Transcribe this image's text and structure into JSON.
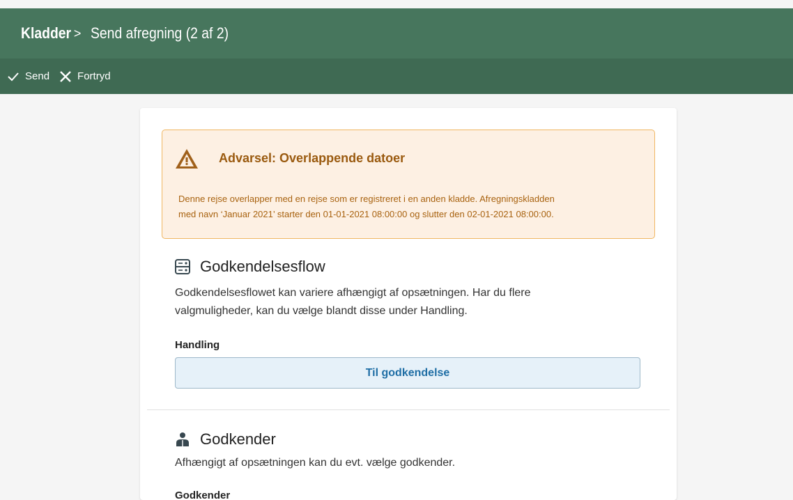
{
  "header": {
    "root": "Kladder",
    "separator": ">",
    "current": "Send afregning (2 af 2)"
  },
  "toolbar": {
    "send_label": "Send",
    "cancel_label": "Fortryd"
  },
  "warning": {
    "title": "Advarsel: Overlappende datoer",
    "line1": "Denne rejse overlapper med en rejse som er registreret i en anden kladde. Afregningskladden",
    "line2": "med navn ‘Januar 2021’ starter den 01-01-2021 08:00:00 og slutter den 02-01-2021 08:00:00."
  },
  "approval_flow": {
    "title": "Godkendelsesflow",
    "line1": "Godkendelsesflowet kan variere afhængigt af opsætningen. Har du flere",
    "line2": "valgmuligheder, kan du vælge blandt disse under Handling.",
    "field_label": "Handling",
    "button_label": "Til godkendelse"
  },
  "approver": {
    "title": "Godkender",
    "text": "Afhængigt af opsætningen kan du evt. vælge godkender.",
    "field_label": "Godkender"
  },
  "colors": {
    "header_bg": "#47765d",
    "toolbar_bg": "#3f6a53",
    "warning_bg": "#fdf0e3",
    "warning_border": "#f0b661",
    "warning_text": "#a8620f",
    "action_button_bg": "#e6f1f9",
    "action_button_text": "#1f6ea5"
  },
  "icons": {
    "send": "checkmark-icon",
    "cancel": "close-icon",
    "warning": "warning-triangle-icon",
    "flow": "flow-icon",
    "approver": "person-icon"
  }
}
